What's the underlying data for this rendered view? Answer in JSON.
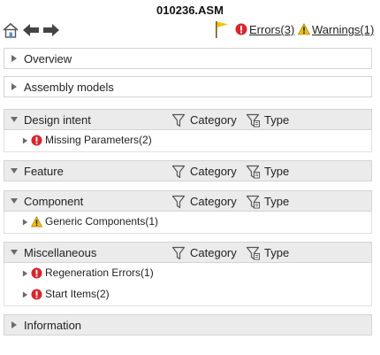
{
  "window": {
    "title": "010236.ASM"
  },
  "toolbar": {
    "home_icon": "home-icon",
    "back_icon": "back-arrow-icon",
    "forward_icon": "forward-arrow-icon",
    "flag_icon": "flag-icon",
    "errors_label": "Errors(3)",
    "warnings_label": "Warnings(1)"
  },
  "filters": {
    "category": "Category",
    "type": "Type"
  },
  "sections": {
    "overview": {
      "label": "Overview"
    },
    "assembly_models": {
      "label": "Assembly models"
    },
    "design_intent": {
      "label": "Design intent",
      "items": [
        {
          "label": "Missing Parameters(2)",
          "status": "error"
        }
      ]
    },
    "feature": {
      "label": "Feature"
    },
    "component": {
      "label": "Component",
      "items": [
        {
          "label": "Generic Components(1)",
          "status": "warning"
        }
      ]
    },
    "miscellaneous": {
      "label": "Miscellaneous",
      "items": [
        {
          "label": "Regeneration Errors(1)",
          "status": "error"
        },
        {
          "label": "Start Items(2)",
          "status": "error"
        }
      ]
    },
    "information": {
      "label": "Information"
    }
  },
  "colors": {
    "error": "#d9262c",
    "warning": "#f2c200",
    "flag": "#f4c20d",
    "bar_open": "#ebebeb"
  }
}
